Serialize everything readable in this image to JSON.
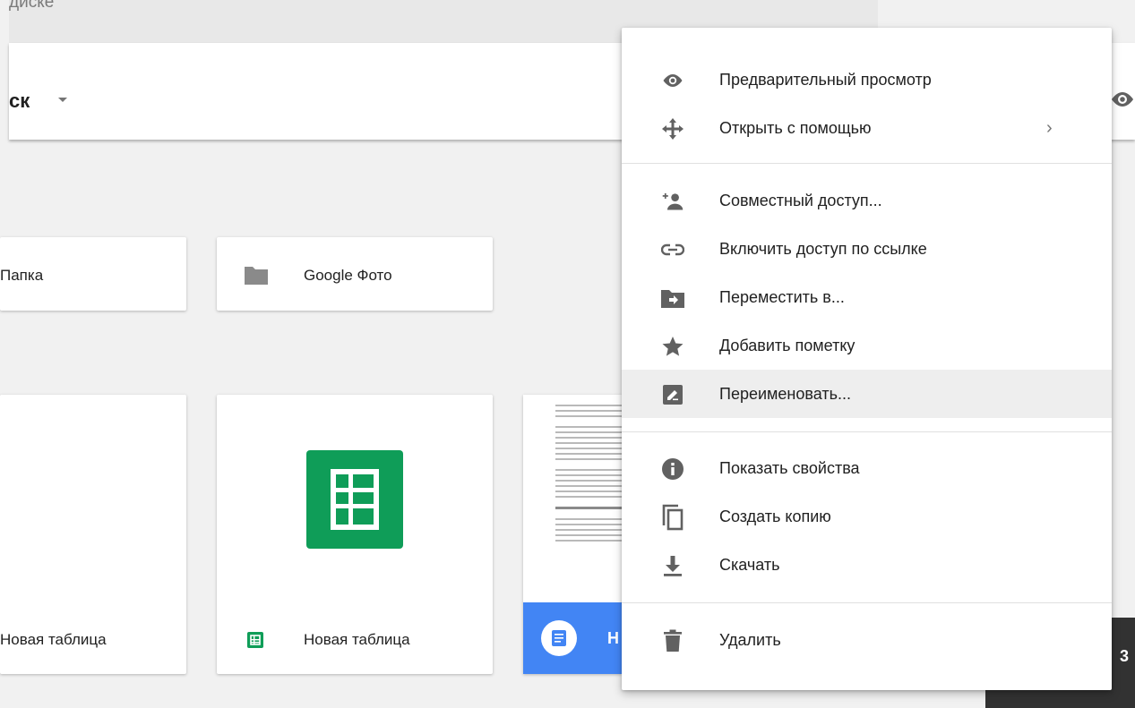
{
  "search": {
    "text": "диске"
  },
  "header": {
    "title": "ск"
  },
  "folders": [
    {
      "label": "Папка"
    },
    {
      "label": "Google Фото"
    }
  ],
  "files": [
    {
      "label": "Новая таблица"
    },
    {
      "label": "Новая таблица"
    },
    {
      "label": "Н"
    }
  ],
  "snackbar": {
    "text": "3"
  },
  "colors": {
    "sheets_green": "#0f9d58",
    "docs_blue": "#4285f4",
    "menu_highlight": "#eeeeee"
  },
  "context_menu": {
    "items": [
      {
        "icon": "eye-icon",
        "label": "Предварительный просмотр"
      },
      {
        "icon": "move-arrows-icon",
        "label": "Открыть с помощью",
        "submenu": "›"
      },
      {
        "icon": "add-person-icon",
        "label": "Совместный доступ..."
      },
      {
        "icon": "link-icon",
        "label": "Включить доступ по ссылке"
      },
      {
        "icon": "move-to-folder-icon",
        "label": "Переместить в..."
      },
      {
        "icon": "star-icon",
        "label": "Добавить пометку"
      },
      {
        "icon": "rename-icon",
        "label": "Переименовать...",
        "highlighted": true
      },
      {
        "icon": "info-icon",
        "label": "Показать свойства"
      },
      {
        "icon": "copy-icon",
        "label": "Создать копию"
      },
      {
        "icon": "download-icon",
        "label": "Скачать"
      },
      {
        "icon": "trash-icon",
        "label": "Удалить"
      }
    ]
  }
}
